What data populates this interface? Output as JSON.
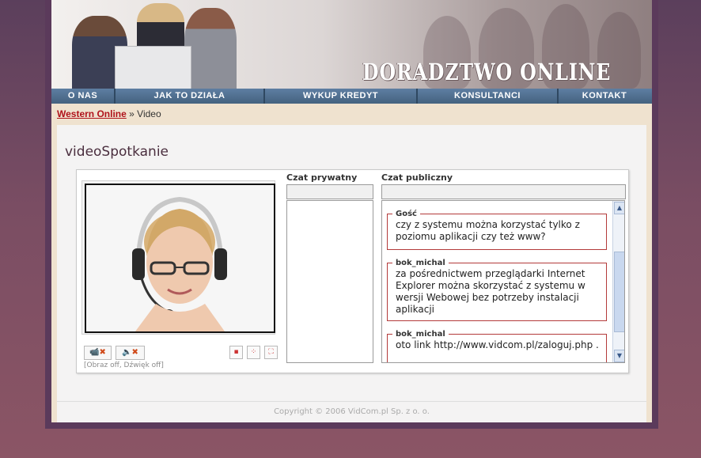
{
  "header": {
    "logo_text": "DORADZTWO ONLINE"
  },
  "nav": {
    "items": [
      {
        "label": "O NAS"
      },
      {
        "label": "JAK TO DZIAŁA"
      },
      {
        "label": "WYKUP KREDYT"
      },
      {
        "label": "KONSULTANCI"
      },
      {
        "label": "KONTAKT"
      }
    ]
  },
  "breadcrumb": {
    "home": "Western Online",
    "separator": "»",
    "current": "Video"
  },
  "main": {
    "title": "videoSpotkanie",
    "video_status": "[Obraz off, Dźwięk off]",
    "private_chat_label": "Czat prywatny",
    "public_chat_label": "Czat publiczny",
    "messages": [
      {
        "author": "Gość",
        "text": "czy z systemu można korzystać tylko z poziomu aplikacji czy też www?"
      },
      {
        "author": "bok_michal",
        "text": "za pośrednictwem przeglądarki Internet Explorer można skorzystać z systemu w wersji Webowej bez potrzeby instalacji aplikacji"
      },
      {
        "author": "bok_michal",
        "text": "oto link http://www.vidcom.pl/zaloguj.php ."
      }
    ]
  },
  "footer": {
    "copyright": "Copyright © 2006 VidCom.pl Sp. z o. o."
  },
  "colors": {
    "nav_bg": "#4d6d8f",
    "accent_red": "#b0121a",
    "msg_border": "#b33a3a"
  }
}
